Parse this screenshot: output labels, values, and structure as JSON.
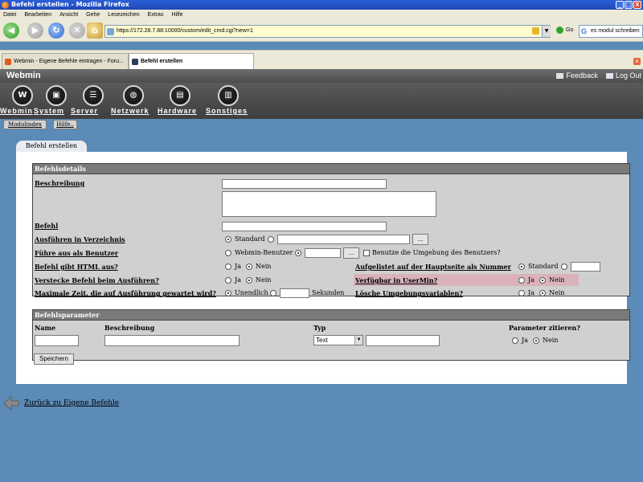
{
  "window": {
    "title": "Befehl erstellen - Mozilla Firefox",
    "controls": [
      "_",
      "□",
      "X"
    ]
  },
  "menu": [
    "Datei",
    "Bearbeiten",
    "Ansicht",
    "Gehe",
    "Lesezeichen",
    "Extras",
    "Hilfe"
  ],
  "nav": {
    "url": "https://172.28.7.88:10000/custom/edit_cmd.cgi?new=1",
    "go_label": "Go",
    "search_value": "es modul schreiben"
  },
  "tabs": [
    {
      "label": "Webmin - Eigene Befehle eintragen - Foru..."
    },
    {
      "label": "Befehl erstellen"
    }
  ],
  "webmin": {
    "title": "Webmin",
    "feedback": "Feedback",
    "logout": "Log Out",
    "categories": [
      {
        "label": "Webmin",
        "icon": "webmin-icon"
      },
      {
        "label": "System",
        "icon": "system-icon"
      },
      {
        "label": "Server",
        "icon": "server-icon"
      },
      {
        "label": "Netzwerk",
        "icon": "network-icon"
      },
      {
        "label": "Hardware",
        "icon": "hardware-icon"
      },
      {
        "label": "Sonstiges",
        "icon": "misc-icon"
      }
    ],
    "subtabs": [
      "Modulindex",
      "Hilfe.."
    ]
  },
  "page_tab": "Befehl erstellen",
  "details": {
    "header": "Befehlsdetails",
    "description_label": "Beschreibung",
    "command_label": "Befehl",
    "dir_label": "Ausführen in Verzeichnis",
    "dir_default": "Standard",
    "browse_label": "...",
    "user_label": "Führe aus als Benutzer",
    "user_webmin": "Webmin-Benutzer",
    "user_env_label": "Benutze die Umgebung des Benutzers?",
    "html_label": "Befehl gibt HTML aus?",
    "yes": "Ja",
    "no": "Nein",
    "listed_label": "Aufgelistet auf der Hauptseite als Nummer",
    "listed_default": "Standard",
    "hide_label": "Verstecke Befehl beim Ausführen?",
    "usermin_label": "Verfügbar in UserMin?",
    "maxtime_label": "Maximale Zeit, die auf Ausführung gewartet wird?",
    "maxtime_unlimited": "Unendlich",
    "maxtime_unit": "Sekunden",
    "clearenv_label": "Lösche Umgebungsvariablen?"
  },
  "params": {
    "header": "Befehlsparameter",
    "col_name": "Name",
    "col_description": "Beschreibung",
    "col_type": "Typ",
    "col_quote": "Parameter zitieren?",
    "type_value": "Text",
    "yes": "Ja",
    "no": "Nein"
  },
  "save_label": "Speichern",
  "back_link": "Zurück zu Eigene Befehle"
}
